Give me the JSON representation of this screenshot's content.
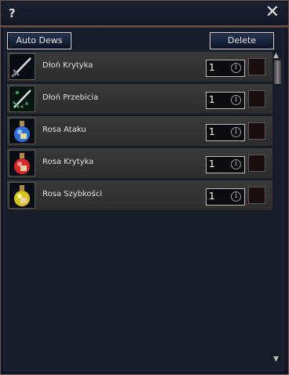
{
  "window": {
    "help_glyph": "?",
    "close_glyph": "✕"
  },
  "toolbar": {
    "auto_label": "Auto Dews",
    "delete_label": "Delete"
  },
  "items": [
    {
      "name": "Dłoń Krytyka",
      "qty": "1",
      "icon": "sword-icon"
    },
    {
      "name": "Dłoń Przebicia",
      "qty": "1",
      "icon": "green-sword-icon"
    },
    {
      "name": "Rosa Ataku",
      "qty": "1",
      "icon": "blue-potion-icon"
    },
    {
      "name": "Rosa Krytyka",
      "qty": "1",
      "icon": "red-potion-icon"
    },
    {
      "name": "Rosa Szybkości",
      "qty": "1",
      "icon": "yellow-potion-icon"
    }
  ],
  "scrollbar": {
    "up_glyph": "▲",
    "down_glyph": "▼"
  }
}
